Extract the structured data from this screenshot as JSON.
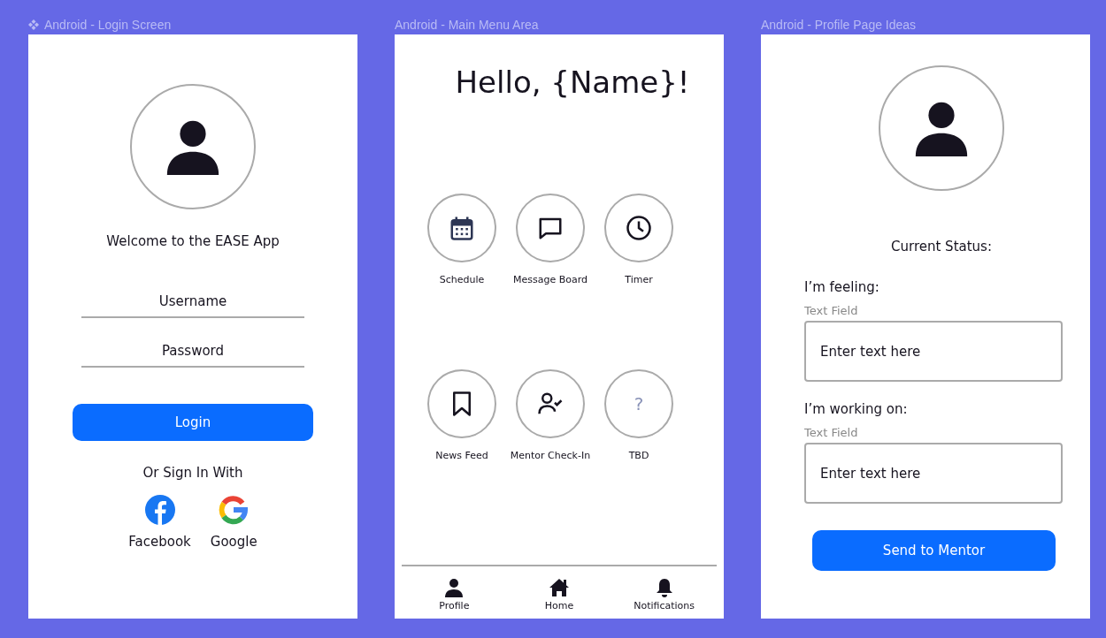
{
  "login_screen": {
    "title": "Android - Login Screen",
    "is_component": true,
    "welcome": "Welcome to the EASE App",
    "fields": [
      {
        "placeholder": "Username"
      },
      {
        "placeholder": "Password"
      }
    ],
    "login_button": "Login",
    "alt_sign_in": "Or Sign In With",
    "providers": [
      {
        "kind": "facebook",
        "label": "Facebook"
      },
      {
        "kind": "google",
        "label": "Google"
      }
    ]
  },
  "main_menu": {
    "title": "Android - Main Menu Area",
    "is_component": false,
    "greeting": "Hello, {Name}!",
    "tiles": [
      {
        "kind": "calendar",
        "label": "Schedule"
      },
      {
        "kind": "chat",
        "label": "Message Board"
      },
      {
        "kind": "clock",
        "label": "Timer"
      },
      {
        "kind": "bookmark",
        "label": "News Feed"
      },
      {
        "kind": "person-check",
        "label": "Mentor Check-In"
      },
      {
        "kind": "glyph",
        "glyph": "?",
        "label": "TBD"
      }
    ],
    "bottom_nav": [
      {
        "kind": "person",
        "label": "Profile"
      },
      {
        "kind": "house",
        "label": "Home"
      },
      {
        "kind": "bell",
        "label": "Notifications"
      }
    ]
  },
  "profile_page": {
    "title": "Android - Profile Page Ideas",
    "is_component": false,
    "status_heading": "Current Status:",
    "fields": [
      {
        "label": "I’m feeling:",
        "hint": "Text Field",
        "placeholder": "Enter text here"
      },
      {
        "label": "I’m working on:",
        "hint": "Text Field",
        "placeholder": "Enter text here"
      }
    ],
    "send_button": "Send to Mentor"
  }
}
